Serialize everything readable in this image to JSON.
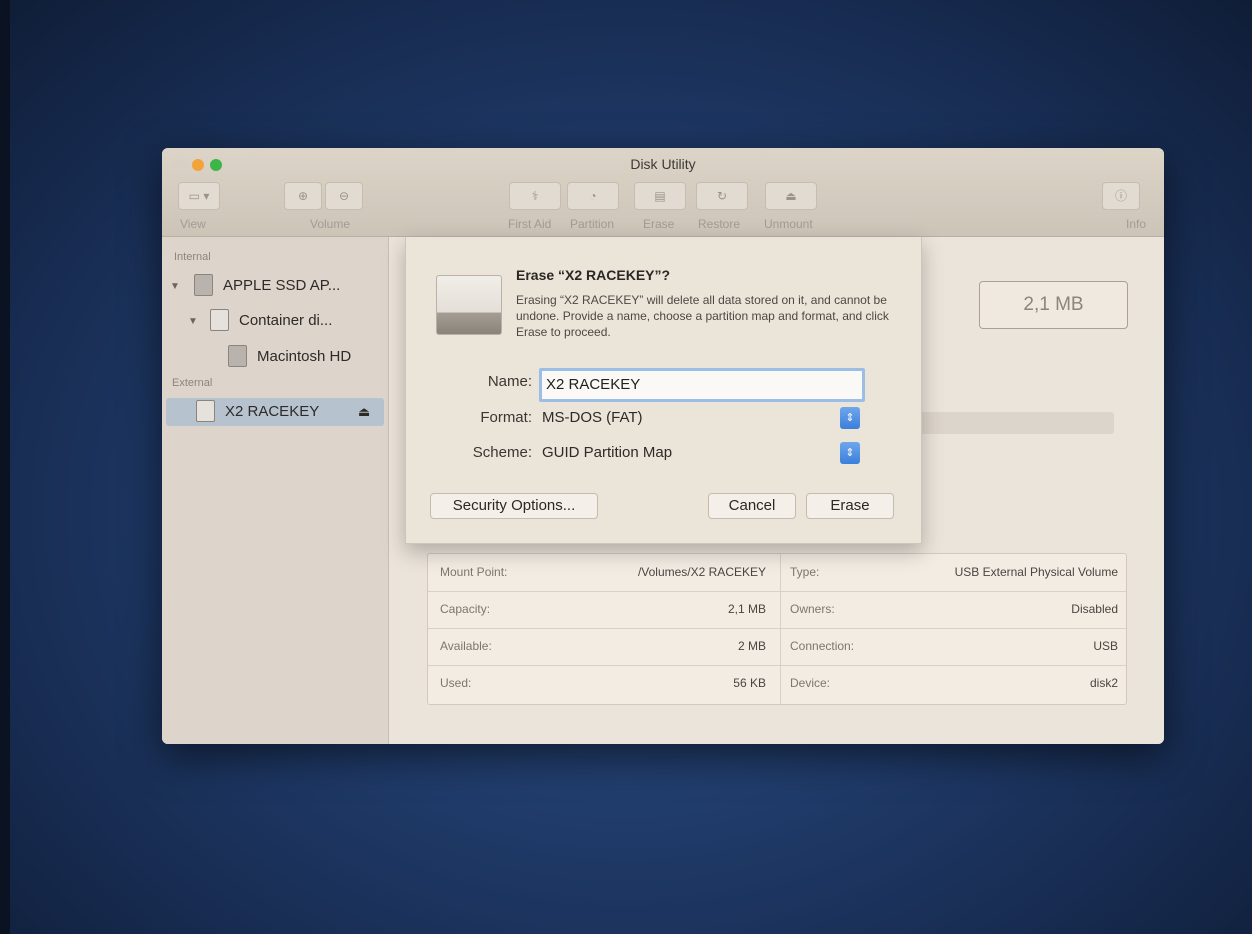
{
  "window": {
    "title": "Disk Utility"
  },
  "toolbar": {
    "view_label": "View",
    "volume_label": "Volume",
    "first_aid_label": "First Aid",
    "partition_label": "Partition",
    "erase_label": "Erase",
    "restore_label": "Restore",
    "unmount_label": "Unmount",
    "info_label": "Info"
  },
  "sidebar": {
    "internal_header": "Internal",
    "external_header": "External",
    "items": [
      {
        "label": "APPLE SSD AP..."
      },
      {
        "label": "Container di..."
      },
      {
        "label": "Macintosh HD"
      },
      {
        "label": "X2 RACEKEY"
      }
    ]
  },
  "volume": {
    "size": "2,1 MB"
  },
  "info": {
    "rows": [
      {
        "left_label": "Mount Point:",
        "left_value": "/Volumes/X2 RACEKEY",
        "right_label": "Type:",
        "right_value": "USB External Physical Volume"
      },
      {
        "left_label": "Capacity:",
        "left_value": "2,1 MB",
        "right_label": "Owners:",
        "right_value": "Disabled"
      },
      {
        "left_label": "Available:",
        "left_value": "2 MB",
        "right_label": "Connection:",
        "right_value": "USB"
      },
      {
        "left_label": "Used:",
        "left_value": "56 KB",
        "right_label": "Device:",
        "right_value": "disk2"
      }
    ]
  },
  "dialog": {
    "title": "Erase “X2 RACEKEY”?",
    "message": "Erasing “X2 RACEKEY” will delete all data stored on it, and cannot be undone. Provide a name, choose a partition map and format, and click Erase to proceed.",
    "name_label": "Name:",
    "name_value": "X2 RACEKEY",
    "format_label": "Format:",
    "format_value": "MS-DOS (FAT)",
    "scheme_label": "Scheme:",
    "scheme_value": "GUID Partition Map",
    "security_button": "Security Options...",
    "cancel_button": "Cancel",
    "erase_button": "Erase"
  }
}
